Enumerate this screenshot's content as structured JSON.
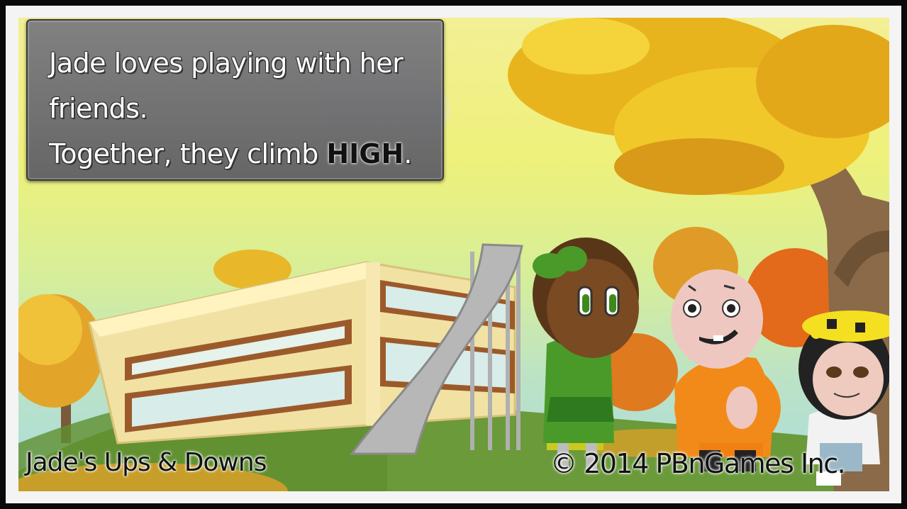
{
  "narration": {
    "line1": "Jade loves playing with her",
    "line2": "friends.",
    "line3_prefix": "Together, they climb",
    "line3_emphasis": "HIGH",
    "line3_suffix": "."
  },
  "footer": {
    "game_title": "Jade's Ups & Downs",
    "copyright": "© 2014 PBnGames Inc."
  },
  "colors": {
    "sky_top": "#f3ef95",
    "sky_bottom": "#a9dce0",
    "grass": "#6a9a3a",
    "leaves": "#e8b41e",
    "building": "#f1e2a4",
    "building_trim": "#9c5a2a",
    "slide": "#b7b7b7",
    "jade_dress": "#4a9a2a",
    "boy_shirt": "#f28a1a"
  },
  "characters": [
    {
      "name": "jade",
      "icon": "girl-green-bow-character"
    },
    {
      "name": "friend-boy",
      "icon": "bald-boy-orange-shirt-character"
    },
    {
      "name": "friend-girl",
      "icon": "girl-flower-crown-character"
    }
  ]
}
